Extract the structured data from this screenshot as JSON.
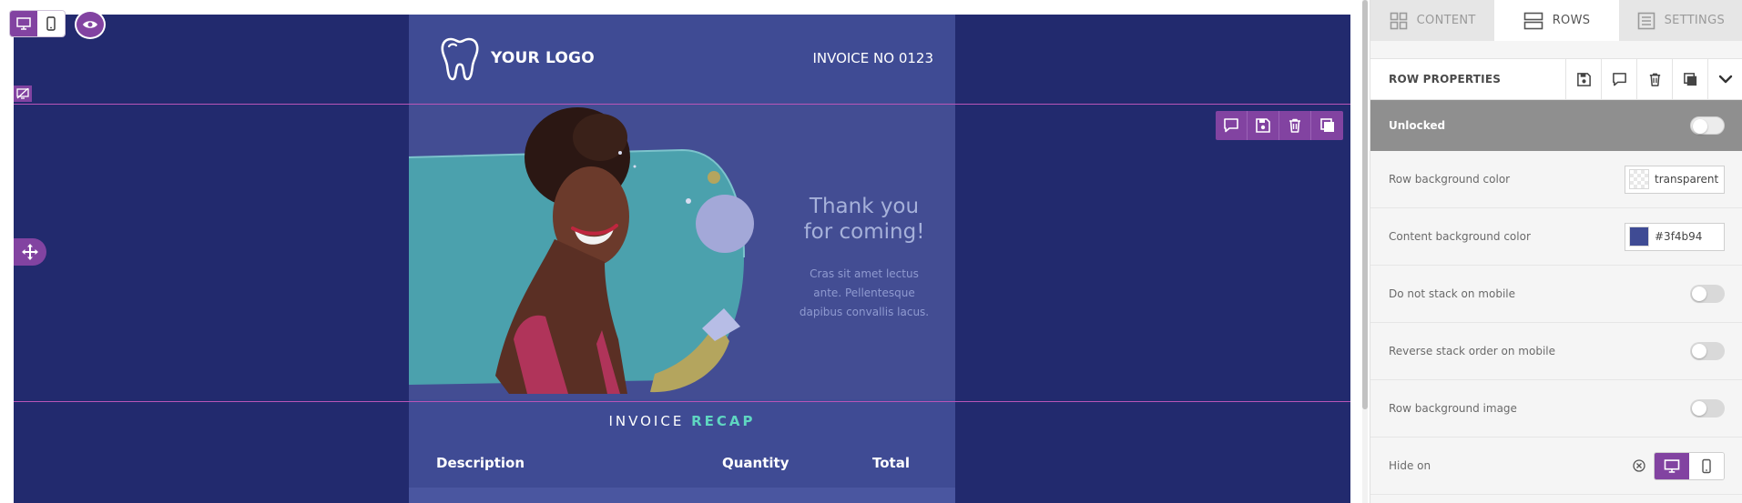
{
  "canvas": {
    "email": {
      "logo_text": "YOUR LOGO",
      "invoice_number": "INVOICE NO 0123",
      "hero_title_line1": "Thank you",
      "hero_title_line2": "for coming!",
      "hero_body_line1": "Cras sit amet lectus",
      "hero_body_line2": "ante. Pellentesque",
      "hero_body_line3": "dapibus convallis lacus.",
      "recap_text": "INVOICE",
      "recap_accent": "RECAP",
      "table_headers": [
        "Description",
        "Quantity",
        "Total"
      ]
    },
    "view_modes": [
      {
        "icon": "desktop-icon",
        "active": true
      },
      {
        "icon": "mobile-icon",
        "active": false
      }
    ],
    "row_toolbar_icons": [
      "comment-icon",
      "save-icon",
      "trash-icon",
      "duplicate-icon"
    ]
  },
  "sidebar": {
    "tabs": [
      {
        "label": "CONTENT",
        "icon": "grid-icon",
        "active": false
      },
      {
        "label": "ROWS",
        "icon": "rows-icon",
        "active": true
      },
      {
        "label": "SETTINGS",
        "icon": "settings-list-icon",
        "active": false
      }
    ],
    "row_properties": {
      "title": "ROW PROPERTIES",
      "unlock_label": "Unlocked",
      "row_bg_label": "Row background color",
      "row_bg_value": "transparent",
      "content_bg_label": "Content background color",
      "content_bg_value": "#3f4b94",
      "no_stack_label": "Do not stack on mobile",
      "reverse_stack_label": "Reverse stack order on mobile",
      "row_bg_image_label": "Row background image",
      "hide_on_label": "Hide on"
    }
  },
  "colors": {
    "accent": "#8243a1",
    "stage_bg": "#222a6e",
    "content_bg": "#3f4b94",
    "recap_accent": "#5fd6c1"
  }
}
